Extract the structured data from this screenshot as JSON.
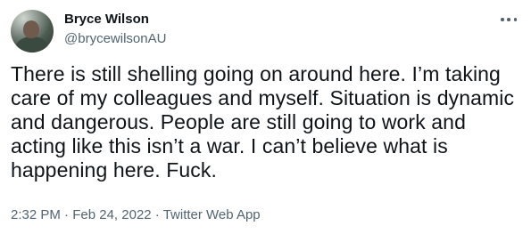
{
  "author": {
    "name": "Bryce Wilson",
    "handle": "@brycewilsonAU"
  },
  "tweet": {
    "text": "There is still shelling going on around here. I’m taking care of my colleagues and myself. Situation is dynamic and dangerous. People are still going to work and acting like this isn’t a war. I can’t believe what is happening here. Fuck."
  },
  "meta": {
    "time": "2:32 PM",
    "separator": " · ",
    "date": "Feb 24, 2022",
    "source": "Twitter Web App"
  },
  "icons": {
    "more": "more-icon",
    "avatar": "avatar"
  }
}
